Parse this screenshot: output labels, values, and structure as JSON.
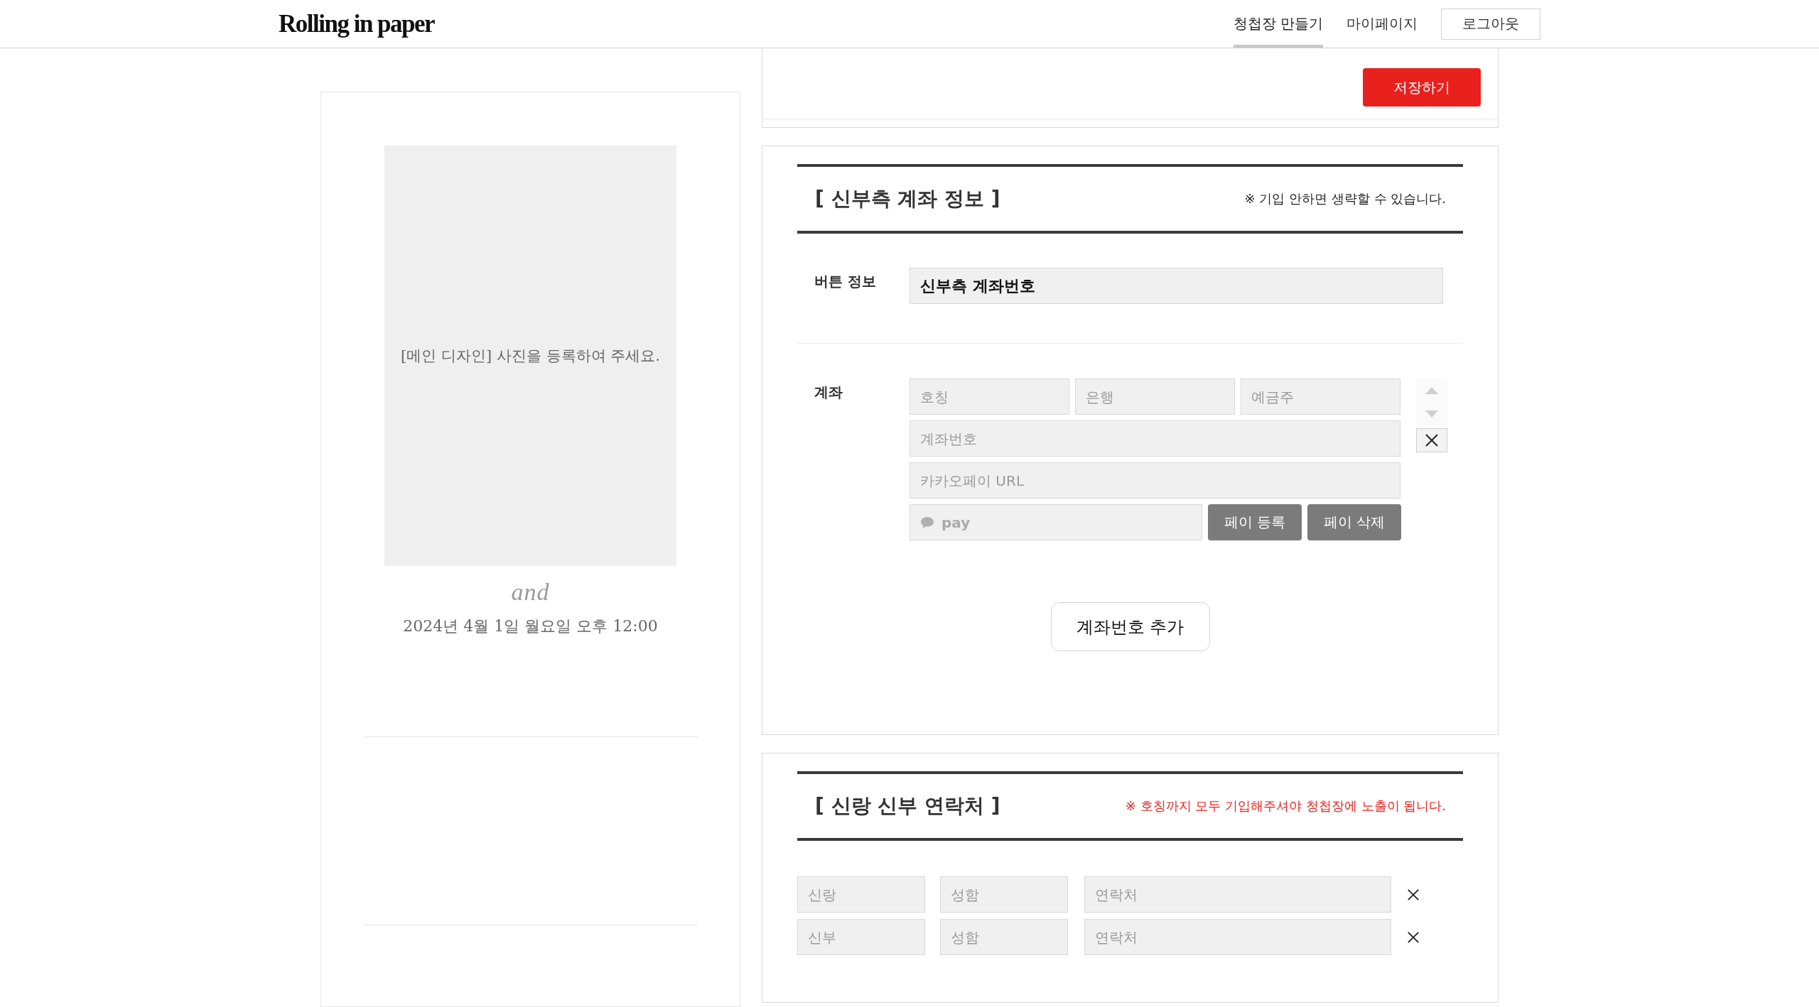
{
  "header": {
    "logo": "Rolling in paper",
    "nav": [
      {
        "label": "청첩장 만들기",
        "selected": true
      },
      {
        "label": "마이페이지",
        "selected": false
      }
    ],
    "logout_button": "로그아웃"
  },
  "preview": {
    "photo_placeholder": "[메인 디자인] 사진을 등록하여 주세요.",
    "and_text": "and",
    "date": "2024년 4월 1일 월요일 오후 12:00"
  },
  "save_button": "저장하기",
  "account_section": {
    "title": "[ 신부측 계좌 정보 ]",
    "note": "※ 기입 안하면 생략할 수 있습니다.",
    "button_info_label": "버튼 정보",
    "button_info_value": "신부측 계좌번호",
    "account_label": "계좌",
    "account": {
      "nickname_placeholder": "호칭",
      "bank_placeholder": "은행",
      "holder_placeholder": "예금주",
      "number_placeholder": "계좌번호",
      "kakaopay_url_placeholder": "카카오페이 URL",
      "pay_placeholder": "pay",
      "pay_register_button": "페이 등록",
      "pay_delete_button": "페이 삭제"
    },
    "add_button": "계좌번호 추가"
  },
  "contact_section": {
    "title": "[ 신랑 신부 연락처 ]",
    "note": "※ 호칭까지 모두 기입해주셔야 청첩장에 노출이 됩니다.",
    "rows": [
      {
        "role_placeholder": "신랑",
        "name_placeholder": "성함",
        "phone_placeholder": "연락처"
      },
      {
        "role_placeholder": "신부",
        "name_placeholder": "성함",
        "phone_placeholder": "연락처"
      }
    ]
  }
}
